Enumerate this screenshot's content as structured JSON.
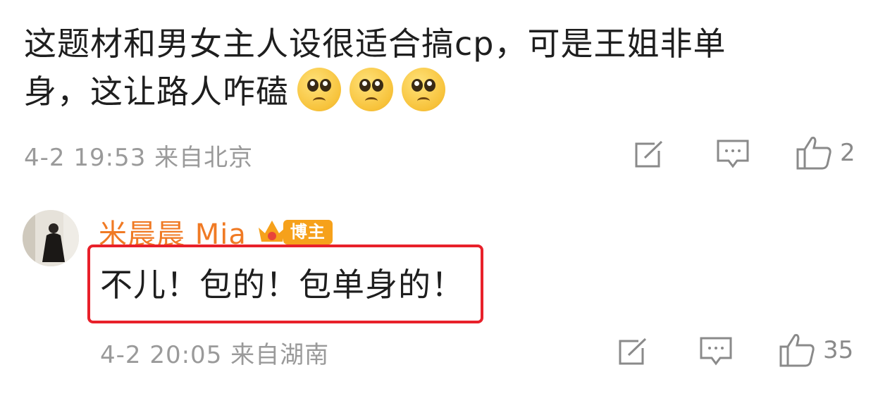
{
  "comment1": {
    "text_line1": "这题材和男女主人设很适合搞cp，可是王姐非单",
    "text_line2": "身，这让路人咋磕",
    "emojis": [
      "pleading-face-emoji",
      "pleading-face-emoji",
      "pleading-face-emoji"
    ],
    "time_location": "4-2 19:53 来自北京",
    "like_count": "2"
  },
  "reply": {
    "username": "米晨晨 Mia",
    "badge_label": "博主",
    "text": "不儿！包的！包单身的！",
    "time_location": "4-2 20:05 来自湖南",
    "like_count": "35"
  },
  "colors": {
    "username": "#f07a24",
    "badge": "#f6a11b",
    "highlight_border": "#e8202a",
    "meta_text": "#9a9a9a"
  },
  "icons": [
    "share-icon",
    "comment-icon",
    "like-icon"
  ]
}
